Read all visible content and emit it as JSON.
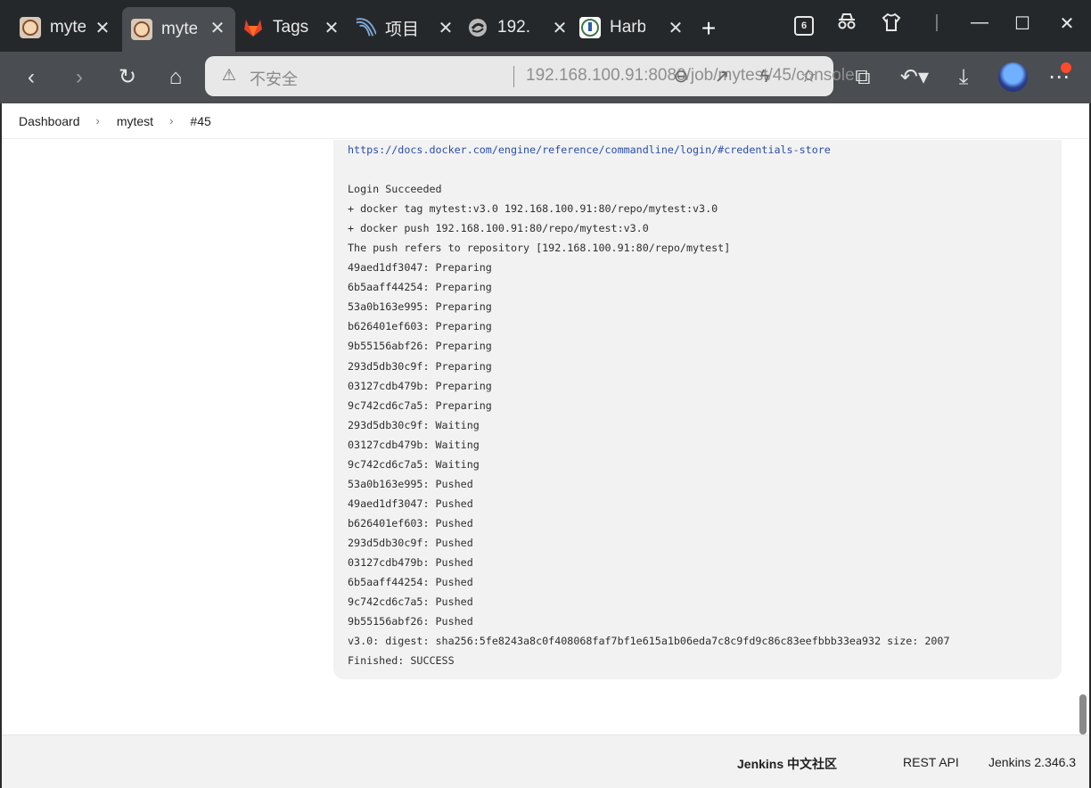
{
  "tabs": [
    {
      "title": "mytest",
      "icon": "jenkins-icon",
      "active": false
    },
    {
      "title": "mytest",
      "icon": "jenkins-icon",
      "active": true
    },
    {
      "title": "Tags",
      "icon": "gitlab-icon",
      "active": false
    },
    {
      "title": "项目",
      "icon": "project-icon",
      "active": false
    },
    {
      "title": "192.",
      "icon": "site-icon",
      "active": false
    },
    {
      "title": "Harb",
      "icon": "harbor-icon",
      "active": false
    }
  ],
  "window": {
    "tab_count": "6",
    "close_glyph": "✕",
    "new_tab_glyph": "+",
    "minimize_glyph": "—",
    "maximize_glyph": "☐"
  },
  "address_bar": {
    "security_label": "不安全",
    "url": "192.168.100.91:8080/job/mytest/45/console"
  },
  "breadcrumb": [
    "Dashboard",
    "mytest",
    "#45"
  ],
  "console": {
    "link": "https://docs.docker.com/engine/reference/commandline/login/#credentials-store",
    "lines": [
      "",
      "Login Succeeded",
      "+ docker tag mytest:v3.0 192.168.100.91:80/repo/mytest:v3.0",
      "+ docker push 192.168.100.91:80/repo/mytest:v3.0",
      "The push refers to repository [192.168.100.91:80/repo/mytest]",
      "49aed1df3047: Preparing",
      "6b5aaff44254: Preparing",
      "53a0b163e995: Preparing",
      "b626401ef603: Preparing",
      "9b55156abf26: Preparing",
      "293d5db30c9f: Preparing",
      "03127cdb479b: Preparing",
      "9c742cd6c7a5: Preparing",
      "293d5db30c9f: Waiting",
      "03127cdb479b: Waiting",
      "9c742cd6c7a5: Waiting",
      "53a0b163e995: Pushed",
      "49aed1df3047: Pushed",
      "b626401ef603: Pushed",
      "293d5db30c9f: Pushed",
      "03127cdb479b: Pushed",
      "6b5aaff44254: Pushed",
      "9c742cd6c7a5: Pushed",
      "9b55156abf26: Pushed",
      "v3.0: digest: sha256:5fe8243a8c0f408068faf7bf1e615a1b06eda7c8c9fd9c86c83eefbbb33ea932 size: 2007",
      "Finished: SUCCESS"
    ]
  },
  "footer": {
    "community": "Jenkins 中文社区",
    "rest_api": "REST API",
    "version": "Jenkins 2.346.3"
  },
  "colors": {
    "tabbar_bg": "#25282b",
    "toolbar_bg": "#4a4d51",
    "console_bg": "#f2f2f3",
    "link": "#2a4ea6",
    "notification": "#ff4b2b"
  }
}
